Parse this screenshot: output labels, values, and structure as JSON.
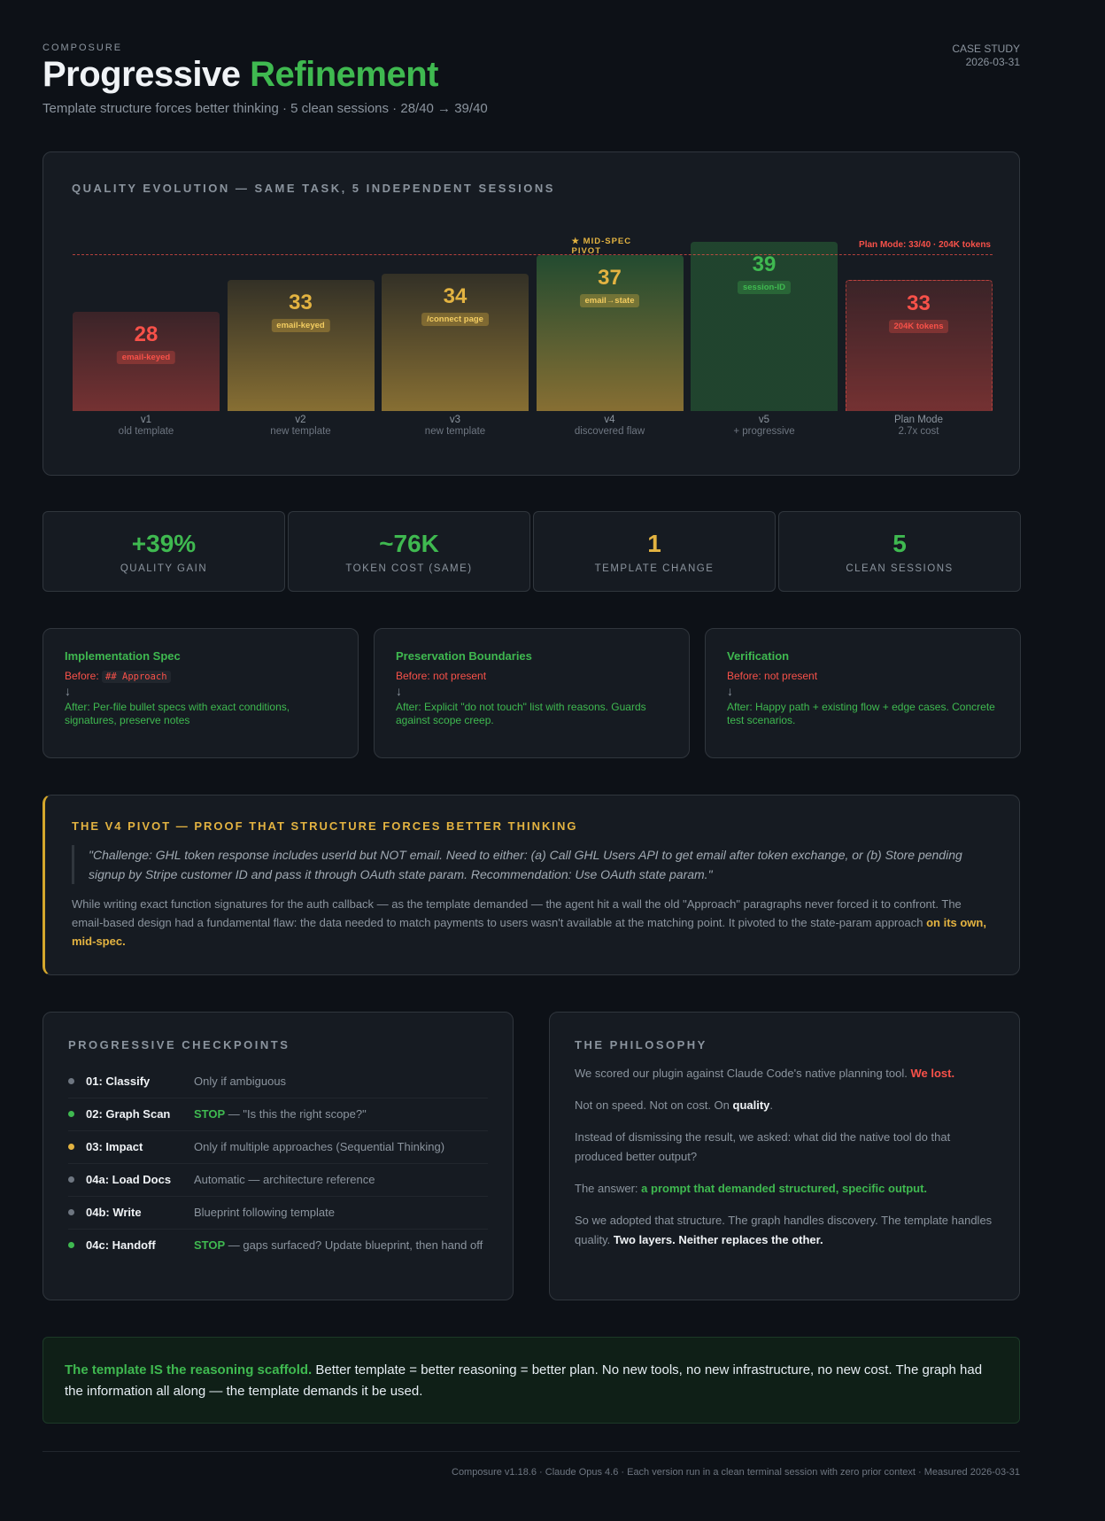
{
  "header": {
    "eyebrow": "COMPOSURE",
    "title_main": "Progressive",
    "title_accent": "Refinement",
    "subtitle": "Template structure forces better thinking · 5 clean sessions · 28/40 → 39/40",
    "case_label": "CASE STUDY",
    "case_date": "2026-03-31"
  },
  "chart_data": {
    "type": "bar",
    "title": "QUALITY EVOLUTION — SAME TASK, 5 INDEPENDENT SESSIONS",
    "categories": [
      "v1",
      "v2",
      "v3",
      "v4",
      "v5",
      "Plan Mode"
    ],
    "sublabels": [
      "old template",
      "new template",
      "new template",
      "discovered flaw",
      "+ progressive",
      "2.7x cost"
    ],
    "values": [
      28,
      33,
      34,
      37,
      39,
      33
    ],
    "tags": [
      "email-keyed",
      "email-keyed",
      "/connect page",
      "email→state",
      "session-ID",
      "204K tokens"
    ],
    "colors": [
      "#f85149",
      "#e3b341",
      "#e3b341",
      "#e3b341",
      "#3fb950",
      "#f85149"
    ],
    "reference_line": {
      "value": 33,
      "label": "Plan Mode: 33/40 · 204K tokens"
    },
    "annotation": "★ MID-SPEC PIVOT"
  },
  "stats": [
    {
      "value": "+39%",
      "label": "QUALITY GAIN",
      "color": "#3fb950"
    },
    {
      "value": "~76K",
      "label": "TOKEN COST (SAME)",
      "color": "#3fb950"
    },
    {
      "value": "1",
      "label": "TEMPLATE CHANGE",
      "color": "#e3b341"
    },
    {
      "value": "5",
      "label": "CLEAN SESSIONS",
      "color": "#3fb950"
    }
  ],
  "compare": [
    {
      "title": "Implementation Spec",
      "before_label": "Before:",
      "before_code": "## Approach",
      "before_text": "",
      "arrow": "↓",
      "after": "After: Per-file bullet specs with exact conditions, signatures, preserve notes"
    },
    {
      "title": "Preservation Boundaries",
      "before_label": "Before: not present",
      "before_code": "",
      "before_text": "",
      "arrow": "↓",
      "after": "After: Explicit \"do not touch\" list with reasons. Guards against scope creep."
    },
    {
      "title": "Verification",
      "before_label": "Before: not present",
      "before_code": "",
      "before_text": "",
      "arrow": "↓",
      "after": "After: Happy path + existing flow + edge cases. Concrete test scenarios."
    }
  ],
  "pivot": {
    "title": "THE V4 PIVOT — PROOF THAT STRUCTURE FORCES BETTER THINKING",
    "quote": "\"Challenge: GHL token response includes userId but NOT email. Need to either: (a) Call GHL Users API to get email after token exchange, or (b) Store pending signup by Stripe customer ID and pass it through OAuth state param. Recommendation: Use OAuth state param.\"",
    "body": "While writing exact function signatures for the auth callback — as the template demanded — the agent hit a wall the old \"Approach\" paragraphs never forced it to confront. The email-based design had a fundamental flaw: the data needed to match payments to users wasn't available at the matching point. It pivoted to the state-param approach",
    "emph": "on its own, mid-spec."
  },
  "checkpoints": {
    "title": "PROGRESSIVE CHECKPOINTS",
    "items": [
      {
        "name": "01: Classify",
        "stop": "",
        "desc": "Only if ambiguous",
        "dot": "#6e7681"
      },
      {
        "name": "02: Graph Scan",
        "stop": "STOP",
        "desc": " — \"Is this the right scope?\"",
        "dot": "#3fb950"
      },
      {
        "name": "03: Impact",
        "stop": "",
        "desc": "Only if multiple approaches (Sequential Thinking)",
        "dot": "#e3b341"
      },
      {
        "name": "04a: Load Docs",
        "stop": "",
        "desc": "Automatic — architecture reference",
        "dot": "#6e7681"
      },
      {
        "name": "04b: Write",
        "stop": "",
        "desc": "Blueprint following template",
        "dot": "#6e7681"
      },
      {
        "name": "04c: Handoff",
        "stop": "STOP",
        "desc": " — gaps surfaced? Update blueprint, then hand off",
        "dot": "#3fb950"
      }
    ]
  },
  "philosophy": {
    "title": "THE PHILOSOPHY",
    "p1": "We scored our plugin against Claude Code's native planning tool.",
    "p1_em": "We lost.",
    "p2": "Not on speed. Not on cost. On",
    "p2_em": "quality",
    "p2_end": ".",
    "p3": "Instead of dismissing the result, we asked: what did the native tool do that produced better output?",
    "p4": "The answer:",
    "p4_em": "a prompt that demanded structured, specific output.",
    "p5": "So we adopted that structure. The graph handles discovery. The template handles quality.",
    "p5_em": "Two layers. Neither replaces the other."
  },
  "conclusion": {
    "em": "The template IS the reasoning scaffold.",
    "text": " Better template = better reasoning = better plan. No new tools, no new infrastructure, no new cost. The graph had the information all along — the template demands it be used."
  },
  "footer": "Composure v1.18.6 · Claude Opus 4.6 · Each version run in a clean terminal session with zero prior context · Measured 2026-03-31"
}
